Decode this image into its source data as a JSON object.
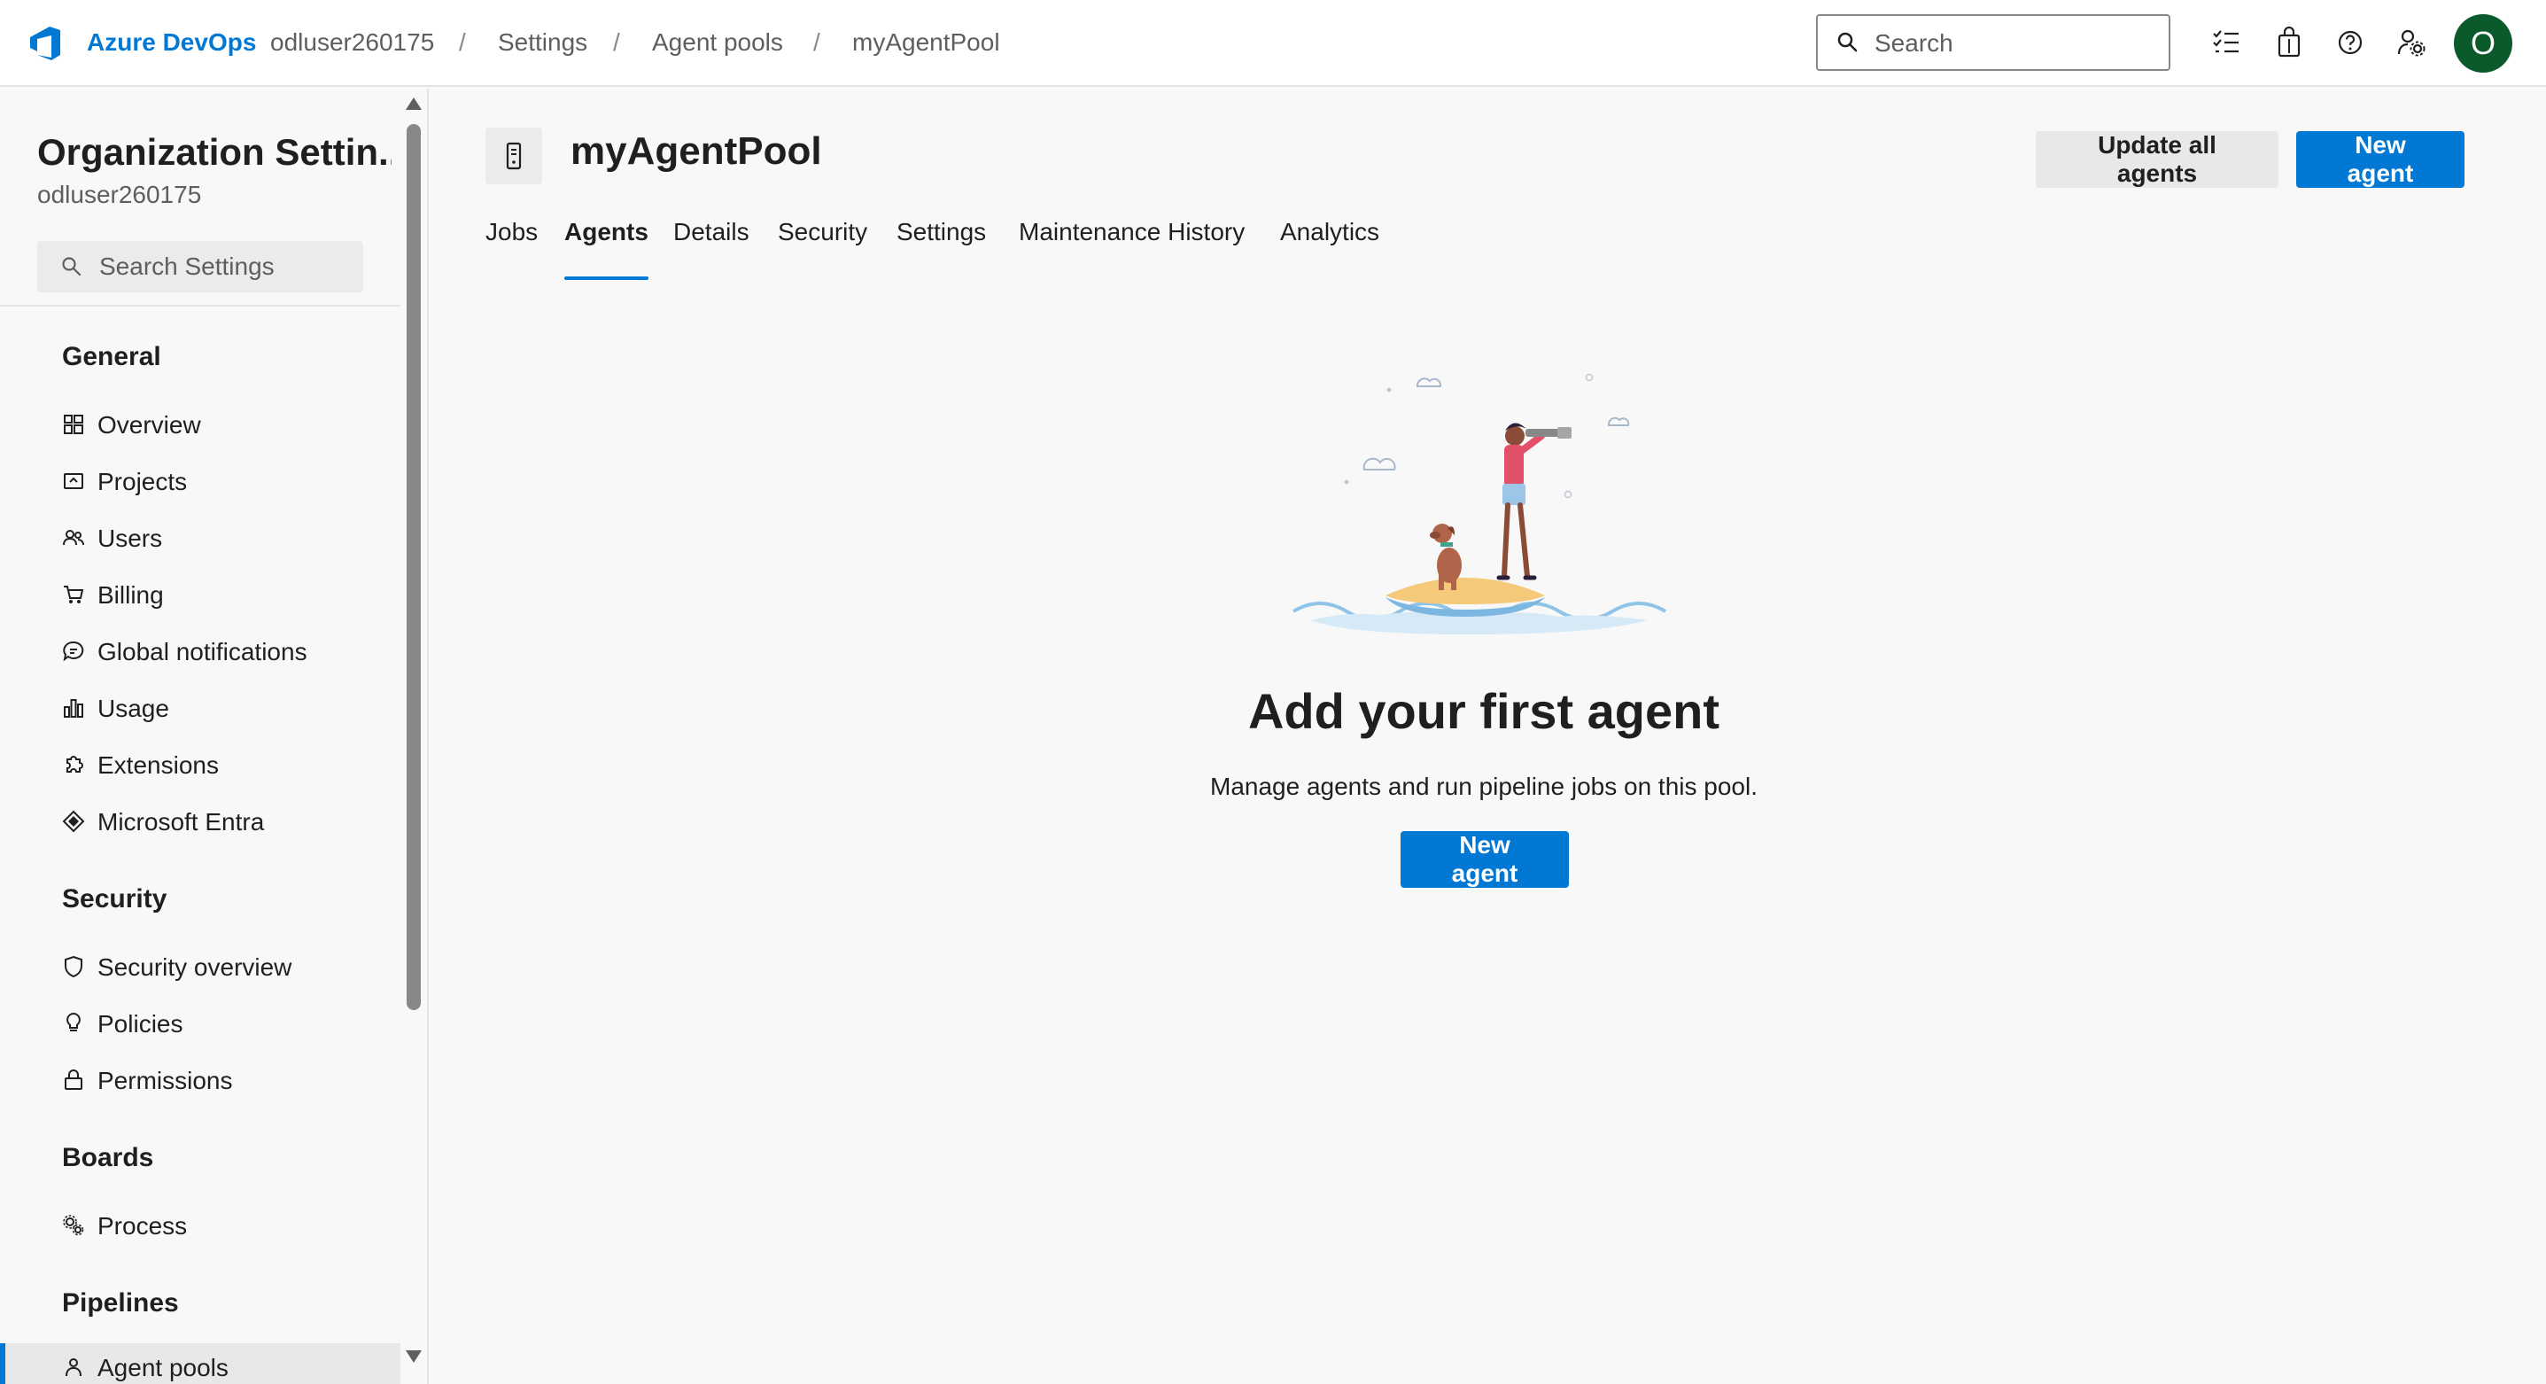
{
  "header": {
    "brand": "Azure DevOps",
    "breadcrumbs": [
      "odluser260175",
      "Settings",
      "Agent pools",
      "myAgentPool"
    ],
    "search_placeholder": "Search",
    "avatar_initial": "O"
  },
  "sidebar": {
    "title": "Organization Settin...",
    "subtitle": "odluser260175",
    "search_placeholder": "Search Settings",
    "sections": [
      {
        "heading": "General",
        "items": [
          "Overview",
          "Projects",
          "Users",
          "Billing",
          "Global notifications",
          "Usage",
          "Extensions",
          "Microsoft Entra"
        ]
      },
      {
        "heading": "Security",
        "items": [
          "Security overview",
          "Policies",
          "Permissions"
        ]
      },
      {
        "heading": "Boards",
        "items": [
          "Process"
        ]
      },
      {
        "heading": "Pipelines",
        "items": [
          "Agent pools"
        ]
      }
    ],
    "active_item": "Agent pools"
  },
  "main": {
    "title": "myAgentPool",
    "update_all_label": "Update all agents",
    "new_agent_label": "New agent",
    "tabs": [
      "Jobs",
      "Agents",
      "Details",
      "Security",
      "Settings",
      "Maintenance History",
      "Analytics"
    ],
    "active_tab": "Agents",
    "empty_state": {
      "title": "Add your first agent",
      "subtitle": "Manage agents and run pipeline jobs on this pool.",
      "button_label": "New agent"
    }
  },
  "colors": {
    "accent": "#0078d4",
    "avatar_bg": "#0b5a2b"
  }
}
